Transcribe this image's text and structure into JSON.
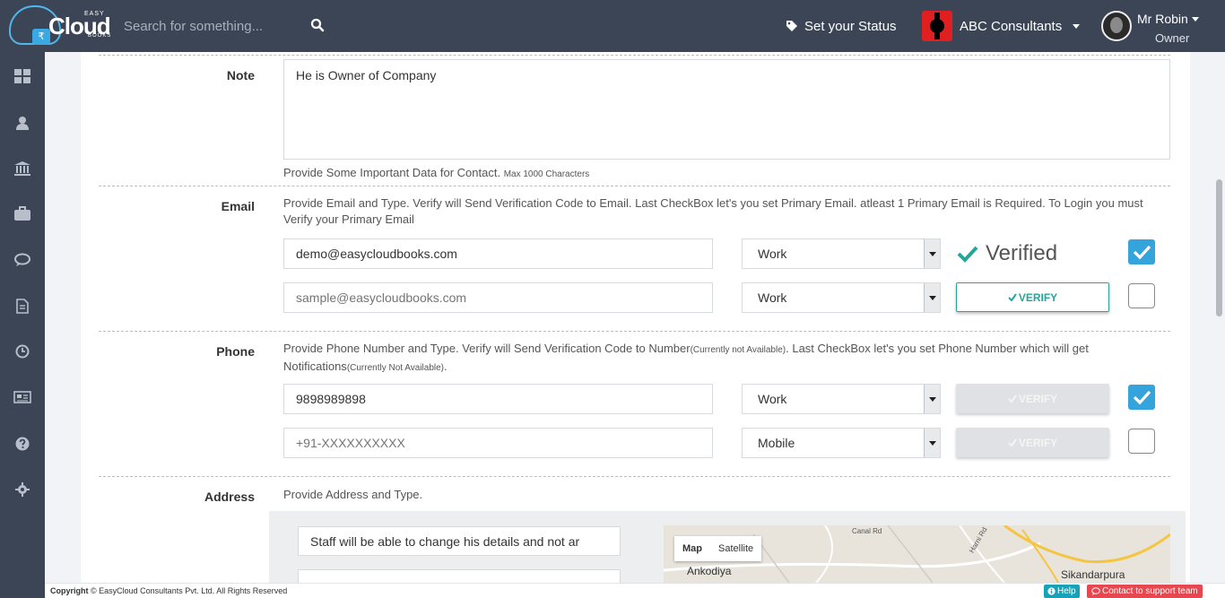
{
  "brand": {
    "easy": "EASY",
    "cloud": "Cloud",
    "books": "BOOKS",
    "currency_symbol": "₹"
  },
  "header": {
    "search_placeholder": "Search for something...",
    "status_label": "Set your Status",
    "company_name": "ABC Consultants",
    "user_name": "Mr Robin",
    "user_role": "Owner"
  },
  "sidebar": {
    "items": [
      {
        "icon": "dashboard-icon"
      },
      {
        "icon": "user-icon"
      },
      {
        "icon": "bank-icon"
      },
      {
        "icon": "briefcase-icon"
      },
      {
        "icon": "chat-icon"
      },
      {
        "icon": "document-icon"
      },
      {
        "icon": "clock-icon"
      },
      {
        "icon": "newspaper-icon"
      },
      {
        "icon": "help-icon"
      },
      {
        "icon": "settings-icon"
      }
    ]
  },
  "note": {
    "label": "Note",
    "value": "He is Owner of Company",
    "help": "Provide Some Important Data for Contact.",
    "help_small": "Max 1000 Characters"
  },
  "email": {
    "label": "Email",
    "help": "Provide Email and Type. Verify will Send Verification Code to Email. Last CheckBox let's you set Primary Email. atleast 1 Primary Email is Required. To Login you must Verify your Primary Email",
    "rows": [
      {
        "value": "demo@easycloudbooks.com",
        "placeholder": "",
        "type": "Work",
        "verified_text": "Verified",
        "primary": true
      },
      {
        "value": "",
        "placeholder": "sample@easycloudbooks.com",
        "type": "Work",
        "verify_label": "VERIFY",
        "primary": false
      }
    ]
  },
  "phone": {
    "label": "Phone",
    "help_1": "Provide Phone Number and Type. Verify will Send Verification Code to Number",
    "help_small_1": "(Currently not Available)",
    "help_2": ". Last CheckBox let's you set Phone Number which will get Notifications",
    "help_small_2": "(Currently Not Available)",
    "help_3": ".",
    "rows": [
      {
        "value": "9898989898",
        "placeholder": "",
        "type": "Work",
        "verify_label": "VERIFY",
        "primary": true
      },
      {
        "value": "",
        "placeholder": "+91-XXXXXXXXXX",
        "type": "Mobile",
        "verify_label": "VERIFY",
        "primary": false
      }
    ]
  },
  "address": {
    "label": "Address",
    "help": "Provide Address and Type.",
    "line1": "Staff will be able to change his details and not ar",
    "map_tabs": [
      "Map",
      "Satellite"
    ],
    "map_places": [
      "Ankodiya",
      "Sikandarpura",
      "Canal Rd",
      "Harni Rd"
    ]
  },
  "footer": {
    "copyright_bold": "Copyright",
    "copyright_text": "© EasyCloud Consultants Pvt. Ltd. All Rights Reserved",
    "help_label": "Help",
    "support_label": "Contact to support team"
  },
  "colors": {
    "topbar": "#3c4556",
    "accent": "#35a3dc",
    "verify_green": "#26a69a",
    "support_red": "#e7474e"
  }
}
